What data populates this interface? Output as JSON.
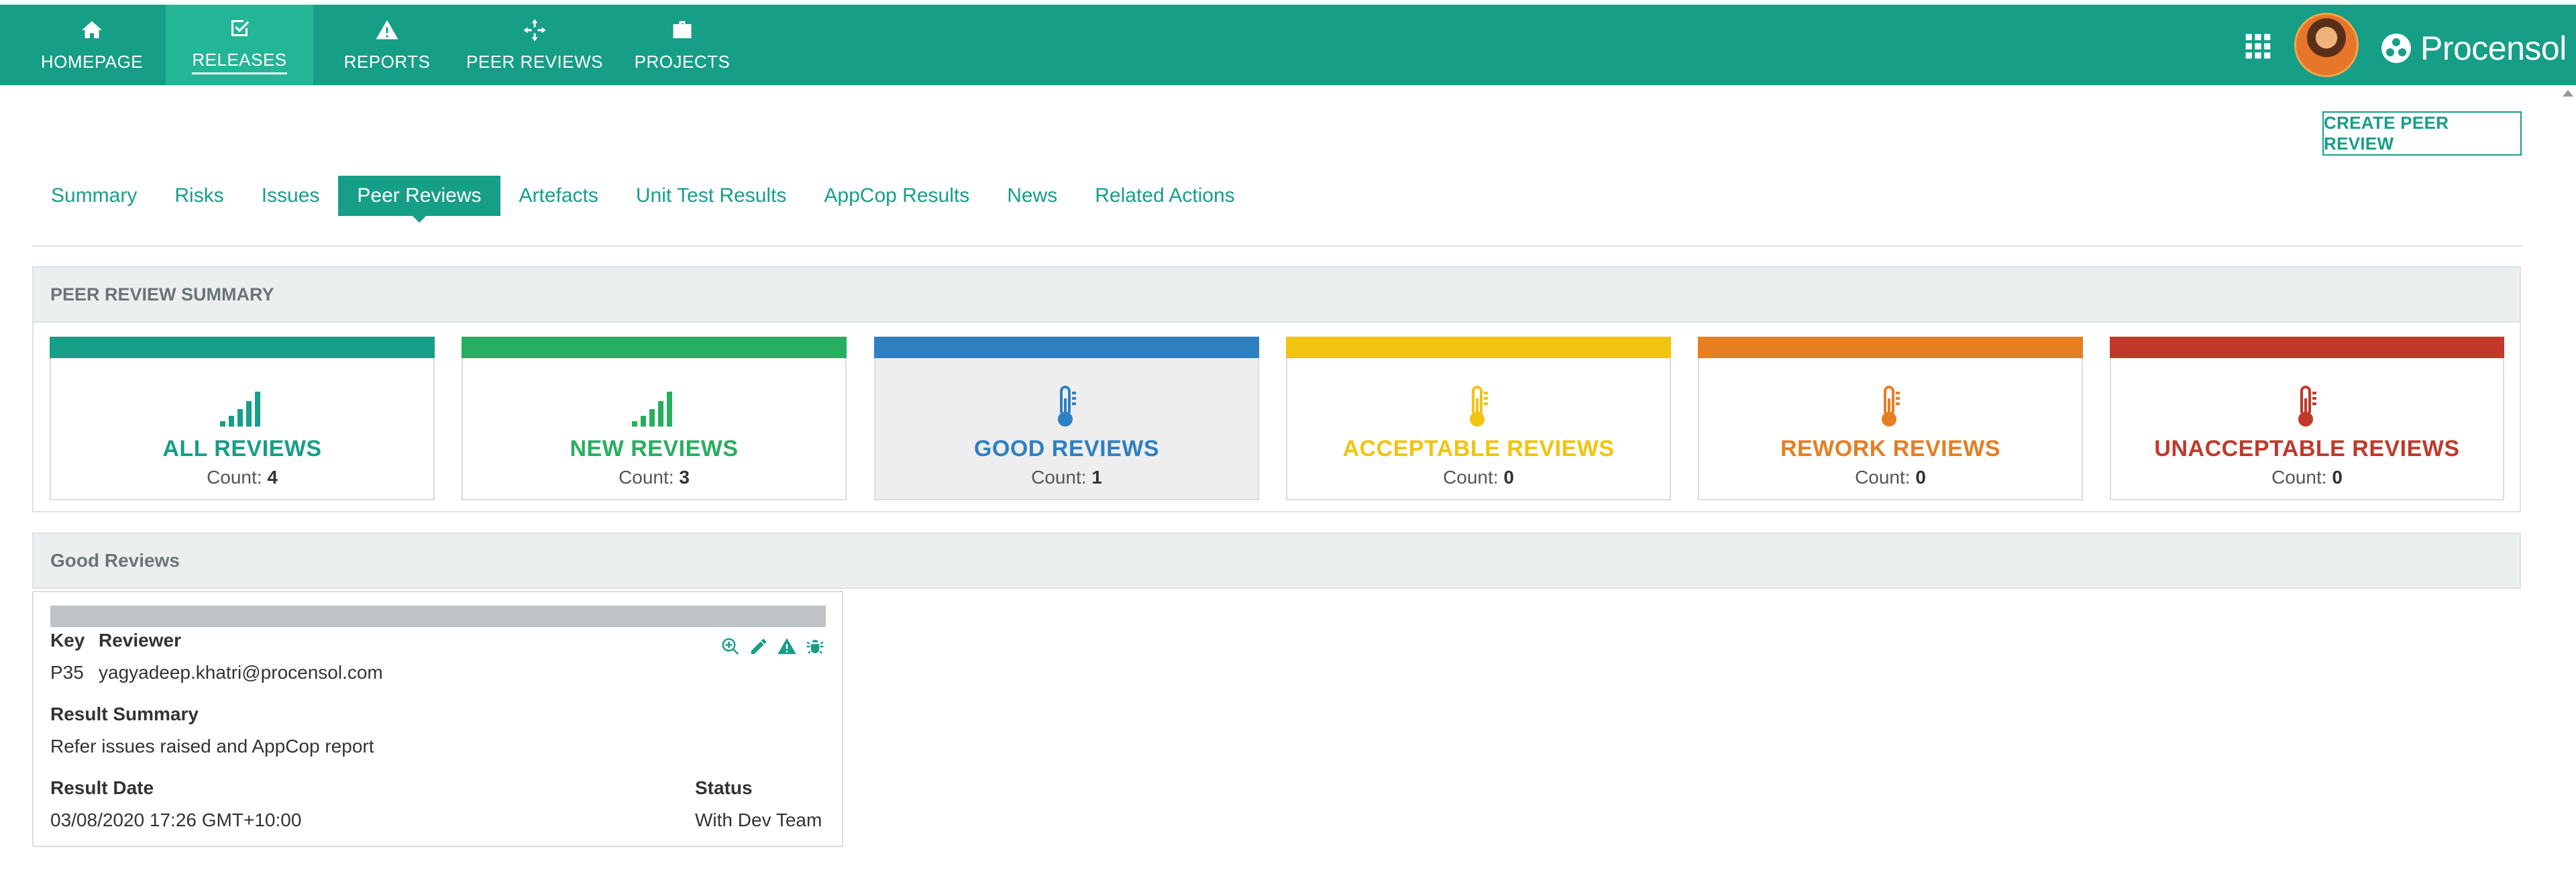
{
  "nav": {
    "items": [
      {
        "label": "HOMEPAGE",
        "icon": "home-icon"
      },
      {
        "label": "RELEASES",
        "icon": "check-square-icon"
      },
      {
        "label": "REPORTS",
        "icon": "warning-icon"
      },
      {
        "label": "PEER REVIEWS",
        "icon": "crosshair-icon"
      },
      {
        "label": "PROJECTS",
        "icon": "briefcase-icon"
      }
    ],
    "active": "RELEASES",
    "brand": "Procensol"
  },
  "actions": {
    "create_label": "CREATE PEER REVIEW"
  },
  "tabs": {
    "items": [
      "Summary",
      "Risks",
      "Issues",
      "Peer Reviews",
      "Artefacts",
      "Unit Test Results",
      "AppCop Results",
      "News",
      "Related Actions"
    ],
    "active": "Peer Reviews"
  },
  "summary": {
    "heading": "PEER REVIEW SUMMARY",
    "cards": [
      {
        "title": "ALL REVIEWS",
        "count_label": "Count:",
        "count": "4",
        "color": "#169e87",
        "icon": "signal-bars-icon"
      },
      {
        "title": "NEW REVIEWS",
        "count_label": "Count:",
        "count": "3",
        "color": "#27ae60",
        "icon": "signal-bars-icon"
      },
      {
        "title": "GOOD REVIEWS",
        "count_label": "Count:",
        "count": "1",
        "color": "#2e80c1",
        "icon": "thermometer-icon"
      },
      {
        "title": "ACCEPTABLE REVIEWS",
        "count_label": "Count:",
        "count": "0",
        "color": "#f1c40f",
        "icon": "thermometer-icon"
      },
      {
        "title": "REWORK REVIEWS",
        "count_label": "Count:",
        "count": "0",
        "color": "#e67e22",
        "icon": "thermometer-icon"
      },
      {
        "title": "UNACCEPTABLE REVIEWS",
        "count_label": "Count:",
        "count": "0",
        "color": "#c0392b",
        "icon": "thermometer-icon"
      }
    ],
    "selected": "GOOD REVIEWS"
  },
  "good_reviews": {
    "heading": "Good Reviews",
    "review": {
      "key_label": "Key",
      "reviewer_label": "Reviewer",
      "key": "P35",
      "reviewer": "yagyadeep.khatri@procensol.com",
      "result_summary_label": "Result Summary",
      "result_summary": "Refer issues raised and AppCop report",
      "result_date_label": "Result Date",
      "result_date": "03/08/2020 17:26 GMT+10:00",
      "status_label": "Status",
      "status": "With Dev Team",
      "action_icons": [
        "zoom-in-icon",
        "edit-pencil-icon",
        "warning-icon",
        "bug-icon"
      ]
    }
  }
}
